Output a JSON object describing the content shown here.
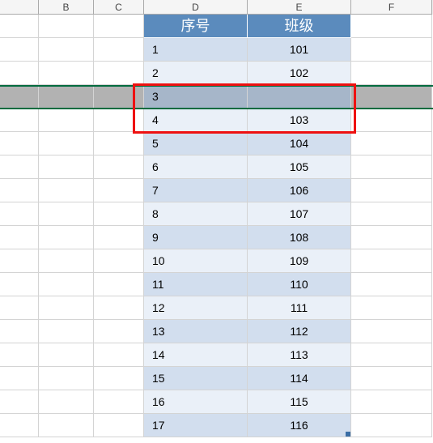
{
  "columns": {
    "b": "B",
    "c": "C",
    "d": "D",
    "e": "E",
    "f": "F"
  },
  "header": {
    "seq": "序号",
    "cls": "班级"
  },
  "rows": [
    {
      "seq": "1",
      "cls": "101"
    },
    {
      "seq": "2",
      "cls": "102"
    },
    {
      "seq": "3",
      "cls": ""
    },
    {
      "seq": "4",
      "cls": "103"
    },
    {
      "seq": "5",
      "cls": "104"
    },
    {
      "seq": "6",
      "cls": "105"
    },
    {
      "seq": "7",
      "cls": "106"
    },
    {
      "seq": "8",
      "cls": "107"
    },
    {
      "seq": "9",
      "cls": "108"
    },
    {
      "seq": "10",
      "cls": "109"
    },
    {
      "seq": "11",
      "cls": "110"
    },
    {
      "seq": "12",
      "cls": "111"
    },
    {
      "seq": "13",
      "cls": "112"
    },
    {
      "seq": "14",
      "cls": "113"
    },
    {
      "seq": "15",
      "cls": "114"
    },
    {
      "seq": "16",
      "cls": "115"
    },
    {
      "seq": "17",
      "cls": "116"
    }
  ],
  "selected_row_index": 2,
  "redbox_rows": [
    2,
    3
  ]
}
